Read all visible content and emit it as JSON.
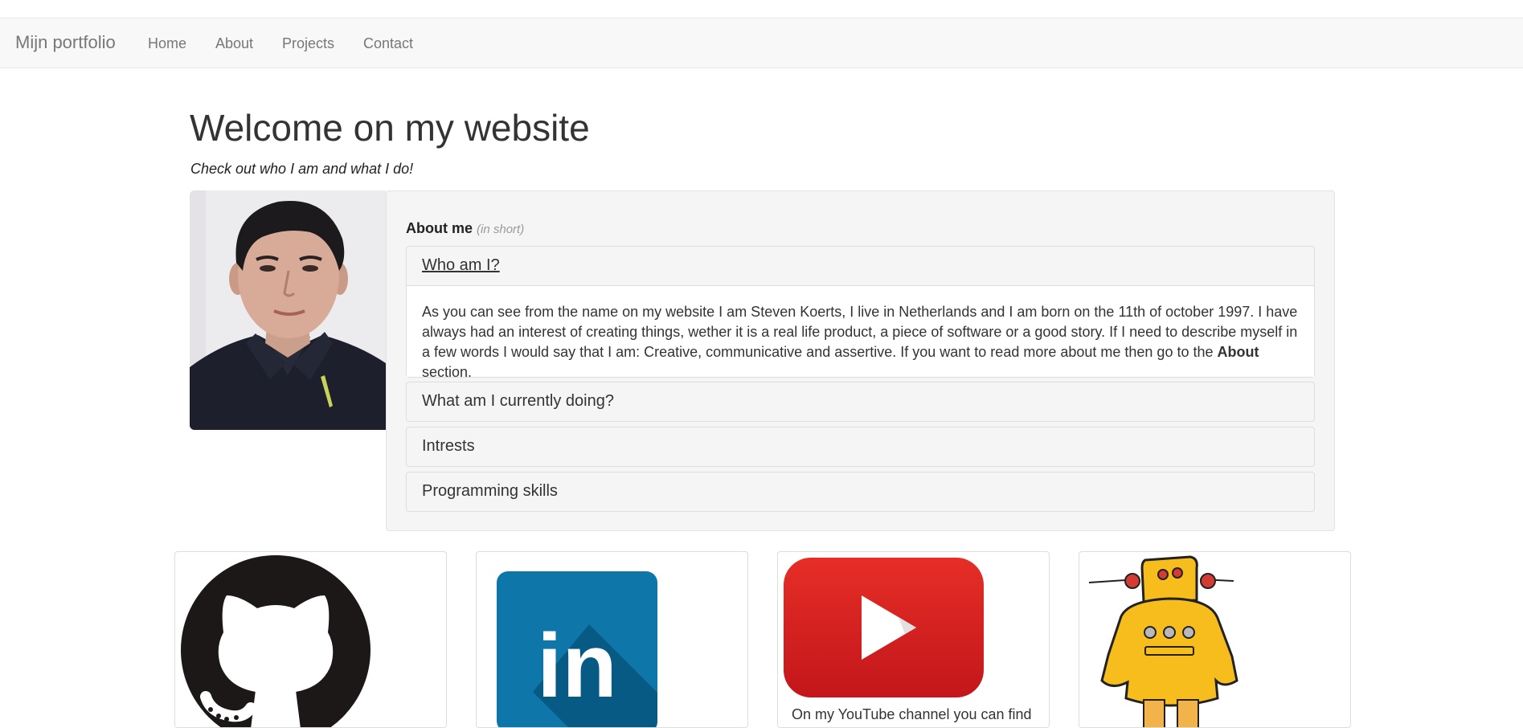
{
  "navbar": {
    "brand": "Mijn portfolio",
    "links": [
      {
        "label": "Home"
      },
      {
        "label": "About"
      },
      {
        "label": "Projects"
      },
      {
        "label": "Contact"
      }
    ]
  },
  "hero": {
    "title": "Welcome on my website",
    "subtitle": "Check out who I am and what I do!"
  },
  "about": {
    "heading": "About me",
    "note": "(in short)",
    "accordion": [
      {
        "title": "Who am I?",
        "expanded": true,
        "body_before": "As you can see from the name on my website I am Steven Koerts, I live in Netherlands and I am born on the 11th of october 1997. I have always had an interest of creating things, wether it is a real life product, a piece of software or a good story. If I need to describe myself in a few words I would say that I am: Creative, communicative and assertive. If you want to read more about me then go to the ",
        "body_bold": "About",
        "body_after": " section."
      },
      {
        "title": "What am I currently doing?",
        "expanded": false
      },
      {
        "title": "Intrests",
        "expanded": false
      },
      {
        "title": "Programming skills",
        "expanded": false
      }
    ]
  },
  "cards": [
    {
      "icon": "github-icon"
    },
    {
      "icon": "linkedin-icon",
      "label": "in"
    },
    {
      "icon": "youtube-icon",
      "caption": "On my YouTube channel you can find"
    },
    {
      "icon": "robot-icon"
    }
  ],
  "colors": {
    "navbar_bg": "#f8f8f8",
    "linkedin_blue": "#0e76a8",
    "youtube_red": "#e62117",
    "robot_yellow": "#f7bd1d",
    "github_black": "#1b1817"
  }
}
